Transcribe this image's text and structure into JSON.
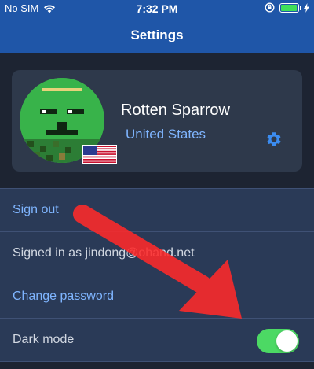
{
  "status_bar": {
    "carrier": "No SIM",
    "time": "7:32 PM",
    "battery_level": 0.95,
    "colors": {
      "background": "#1f56a8",
      "battery": "#3fe05a"
    },
    "icons": [
      "wifi-icon",
      "orientation-lock-icon",
      "battery-icon",
      "charging-bolt-icon"
    ]
  },
  "nav": {
    "title": "Settings"
  },
  "profile": {
    "name": "Rotten Sparrow",
    "country": "United States",
    "avatar_icon": "pixel-face-avatar",
    "flag_icon": "us-flag-icon",
    "settings_icon": "gear-icon"
  },
  "settings": {
    "rows": [
      {
        "label": "Sign out"
      },
      {
        "label": "Signed in as jindong@ohand.net"
      },
      {
        "label": "Change password"
      },
      {
        "label": "Dark mode",
        "toggle_on": true
      }
    ]
  },
  "colors": {
    "background": "#1d2432",
    "card": "#2e394b",
    "list": "#2a3a57",
    "link": "#7fb5ff",
    "toggle_on": "#4cd964",
    "annotation_arrow": "#ff2a2a"
  }
}
